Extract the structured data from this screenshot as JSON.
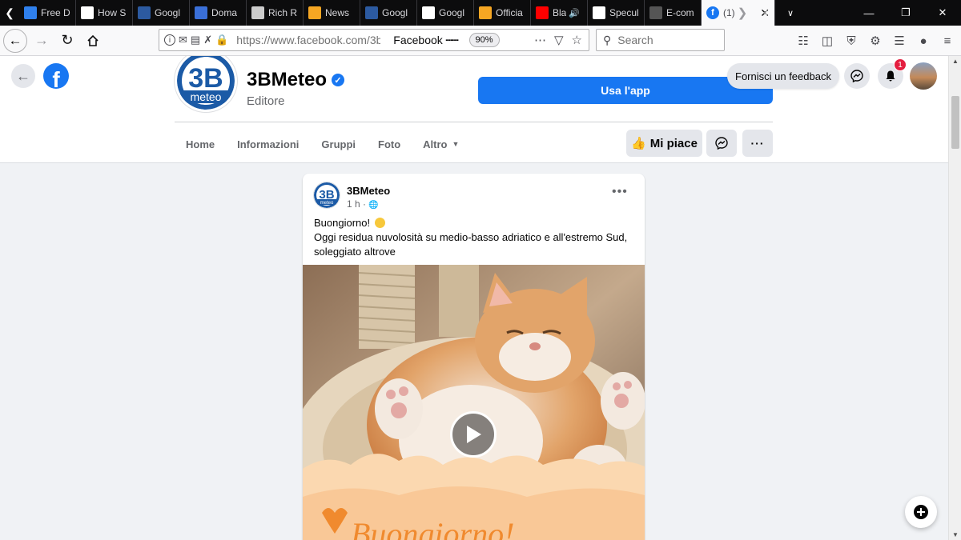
{
  "browser": {
    "tabs": [
      {
        "title": "Free D",
        "icon": "m-icon",
        "color": "#2f80ed"
      },
      {
        "title": "How S",
        "icon": "se-icon",
        "color": "#ffffff"
      },
      {
        "title": "Googl",
        "icon": "sej-icon",
        "color": "#2c5aa0"
      },
      {
        "title": "Doma",
        "icon": "domain-icon",
        "color": "#3a6fd8"
      },
      {
        "title": "Rich R",
        "icon": "rich-icon",
        "color": "#cccccc"
      },
      {
        "title": "News",
        "icon": "news-icon",
        "color": "#f5a623"
      },
      {
        "title": "Googl",
        "icon": "sej-icon",
        "color": "#2c5aa0"
      },
      {
        "title": "Googl",
        "icon": "se-icon",
        "color": "#ffffff"
      },
      {
        "title": "Officia",
        "icon": "official-icon",
        "color": "#f5a623"
      },
      {
        "title": "Bla",
        "icon": "youtube-icon",
        "color": "#ff0000"
      },
      {
        "title": "Specul",
        "icon": "medium-icon",
        "color": "#ffffff"
      },
      {
        "title": "E-com",
        "icon": "ecom-icon",
        "color": "#555555"
      }
    ],
    "active_tab": {
      "title": "(1)",
      "icon": "facebook-icon"
    },
    "url_prefix": "https://www.facebook.com/",
    "url_rest": "3bm",
    "page_title": "Facebook",
    "zoom": "90%",
    "search_placeholder": "Search"
  },
  "facebook": {
    "feedback_label": "Fornisci un feedback",
    "notification_count": "1",
    "page": {
      "name": "3BMeteo",
      "category": "Editore",
      "use_app_label": "Usa l'app",
      "tabs": [
        "Home",
        "Informazioni",
        "Gruppi",
        "Foto",
        "Altro"
      ],
      "like_label": "Mi piace"
    },
    "post": {
      "author": "3BMeteo",
      "time": "1 h ·",
      "line1": "Buongiorno!",
      "line2": "Oggi residua nuvolosità su medio-basso adriatico e all'estremo Sud, soleggiato altrove",
      "overlay_text": "Buongiorno!"
    },
    "logo_text": {
      "big": "3B",
      "small": "meteo"
    }
  },
  "colors": {
    "facebook_blue": "#1877f2",
    "notification_red": "#e41e3f",
    "brand_navy": "#1b5aa6"
  }
}
